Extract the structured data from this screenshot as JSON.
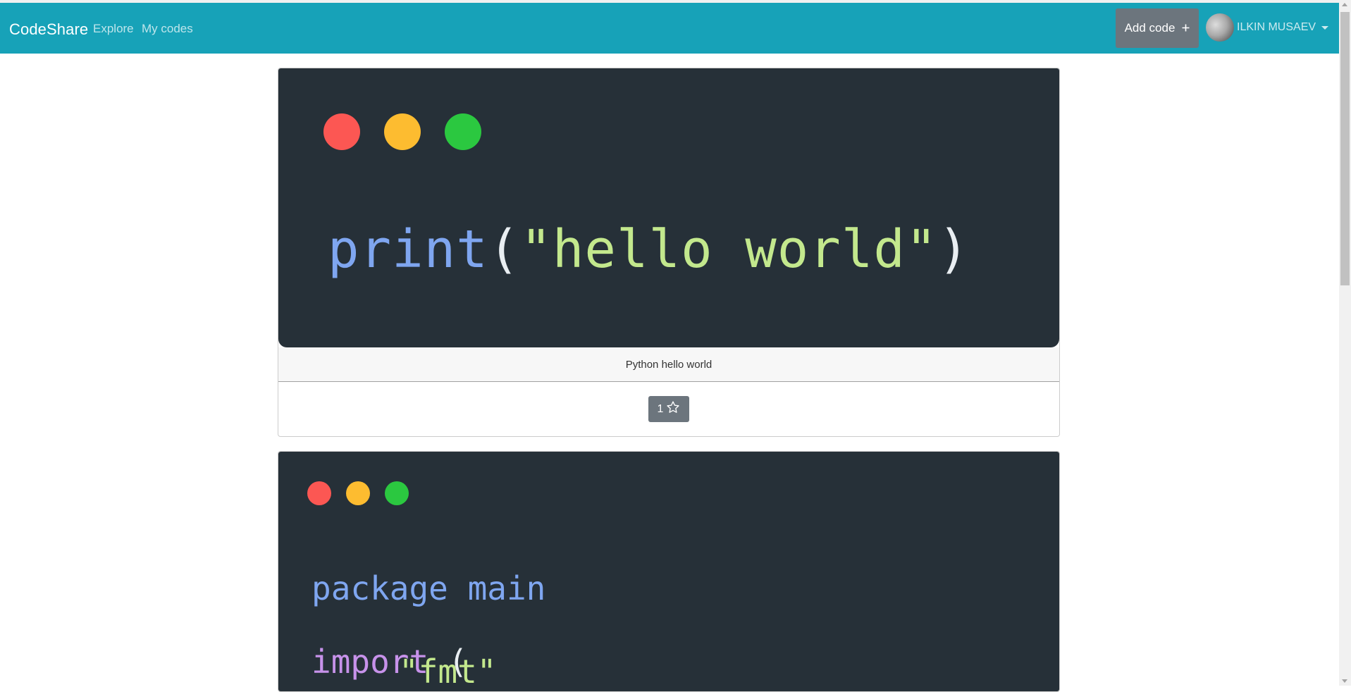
{
  "navbar": {
    "brand": "CodeShare",
    "links": [
      "Explore",
      "My codes"
    ],
    "add_code_label": "Add code",
    "add_code_icon": "plus-icon",
    "user_name": "ILKIN MUSAEV",
    "accent_color": "#17a2b8"
  },
  "snippets": [
    {
      "title": "Python hello world",
      "stars": "1",
      "code": {
        "func": "print",
        "open": "(",
        "string": "\"hello world\"",
        "close": ")"
      }
    },
    {
      "code": {
        "kw_package": "package",
        "pkg_name": "main",
        "kw_import": "import",
        "open": "(",
        "string": "\"fmt\""
      }
    }
  ]
}
